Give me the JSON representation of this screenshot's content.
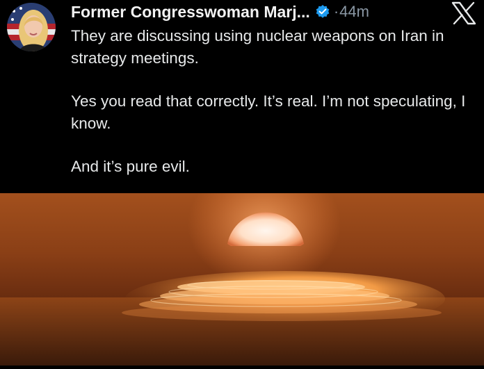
{
  "post": {
    "author_name": "Former Congresswoman Marj...",
    "time_separator": "·",
    "timestamp": "44m",
    "paragraphs": [
      "They are discussing using nuclear weapons on Iran in strategy meetings.",
      "Yes you read that correctly.  It’s real.  I’m not speculating, I know.",
      "And it’s pure evil."
    ]
  },
  "icons": {
    "verified": "verified-badge-icon",
    "platform": "x-logo-icon"
  },
  "colors": {
    "background": "#000000",
    "text": "#e7e9ea",
    "muted": "#8b98a5",
    "verified": "#1d9bf0",
    "image_glow": "#f4a24a"
  },
  "media": {
    "subject": "nuclear-explosion-photo"
  }
}
